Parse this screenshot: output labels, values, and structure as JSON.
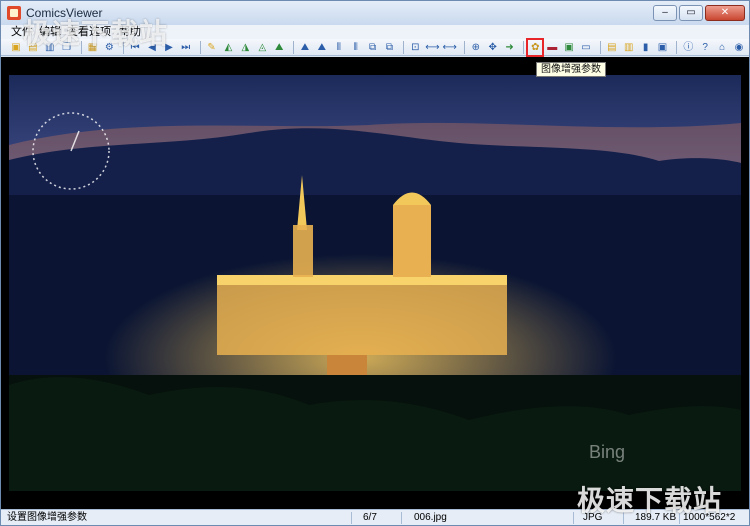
{
  "window": {
    "title": "ComicsViewer",
    "controls": [
      "–",
      "▭",
      "✕"
    ]
  },
  "menu": [
    "文件",
    "编辑",
    "查看",
    "选项",
    "帮助"
  ],
  "toolbar": {
    "buttons": [
      "open-folder",
      "open-file",
      "save",
      "copy",
      "paste",
      "settings",
      "first",
      "prev",
      "play",
      "next",
      "edit",
      "rotate-left",
      "rotate-right",
      "flip",
      "zoom",
      "fit",
      "actual",
      "center",
      "image-enhance",
      "slideshow",
      "color",
      "view-mode",
      "info",
      "help",
      "about"
    ],
    "tooltip": "图像增强参数"
  },
  "watermark": {
    "top": "极速下载站",
    "bottom": "极速下载站"
  },
  "overlay": {
    "bing": "Bing"
  },
  "status": {
    "hint": "设置图像增强参数",
    "page": "6/7",
    "filename": "006.jpg",
    "format": "JPG",
    "size": "189.7 KB",
    "dims": "1000*562*2"
  }
}
